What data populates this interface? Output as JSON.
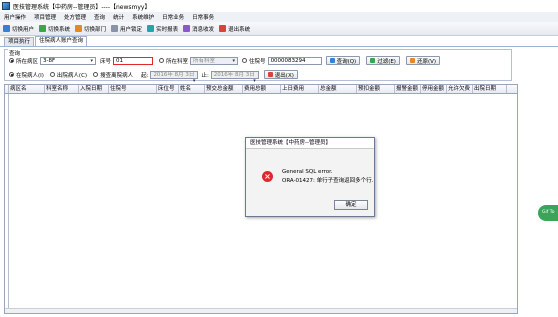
{
  "window": {
    "title": "医技管理系统【中药房--管理员】----【newsmyy】"
  },
  "menu": [
    "用户操作",
    "项目管理",
    "处方管理",
    "查询",
    "统计",
    "系统维护",
    "日常业务",
    "日常事务"
  ],
  "toolbar": [
    {
      "label": "切换用户",
      "icon": "user-switch-icon",
      "color": "blue"
    },
    {
      "label": "切换系统",
      "icon": "system-switch-icon",
      "color": "green"
    },
    {
      "label": "切换部门",
      "icon": "department-switch-icon",
      "color": "orange"
    },
    {
      "label": "用户锁定",
      "icon": "lock-icon",
      "color": "gray"
    },
    {
      "label": "实时报表",
      "icon": "report-icon",
      "color": "teal"
    },
    {
      "label": "消息收发",
      "icon": "message-icon",
      "color": "purple"
    },
    {
      "label": "退出系统",
      "icon": "exit-icon",
      "color": "red"
    }
  ],
  "tabs": [
    "项目执行",
    "住院病人账户查询"
  ],
  "query": {
    "legend": "查询",
    "ward_label": "所在病区",
    "ward_value": "3-8F",
    "bed_label": "床号",
    "bed_value": "01",
    "dept_label": "所在科室",
    "dept_value": "所有科室",
    "admission_label": "住院号",
    "admission_value": "0000083294",
    "search_btn": "查询(Q)",
    "filter_btn": "过滤(E)",
    "restore_btn": "还原(V)",
    "in_hospital": "在院病人(I)",
    "discharged": "出院病人(C)",
    "search_discharged": "搜查离院病人",
    "from_label": "起:",
    "from_date": "2016年 8月 3日",
    "to_label": "止:",
    "to_date": "2016年 8月 3日",
    "exit_btn": "退出(X)"
  },
  "grid": {
    "columns": [
      "病区名",
      "科室名称",
      "入院日期",
      "住院号",
      "床位号",
      "姓名",
      "预交总金额",
      "费用总额",
      "上日费用",
      "总金额",
      "预扣金额",
      "报警金额",
      "停用金额",
      "允许欠费",
      "出院日期"
    ]
  },
  "dialog": {
    "title": "医技管理系统【中药房--管理员】",
    "line1": "General SQL error.",
    "line2": "ORA-01427: 单行子查询返回多个行.",
    "ok": "确定"
  },
  "bubble": "Gif To"
}
